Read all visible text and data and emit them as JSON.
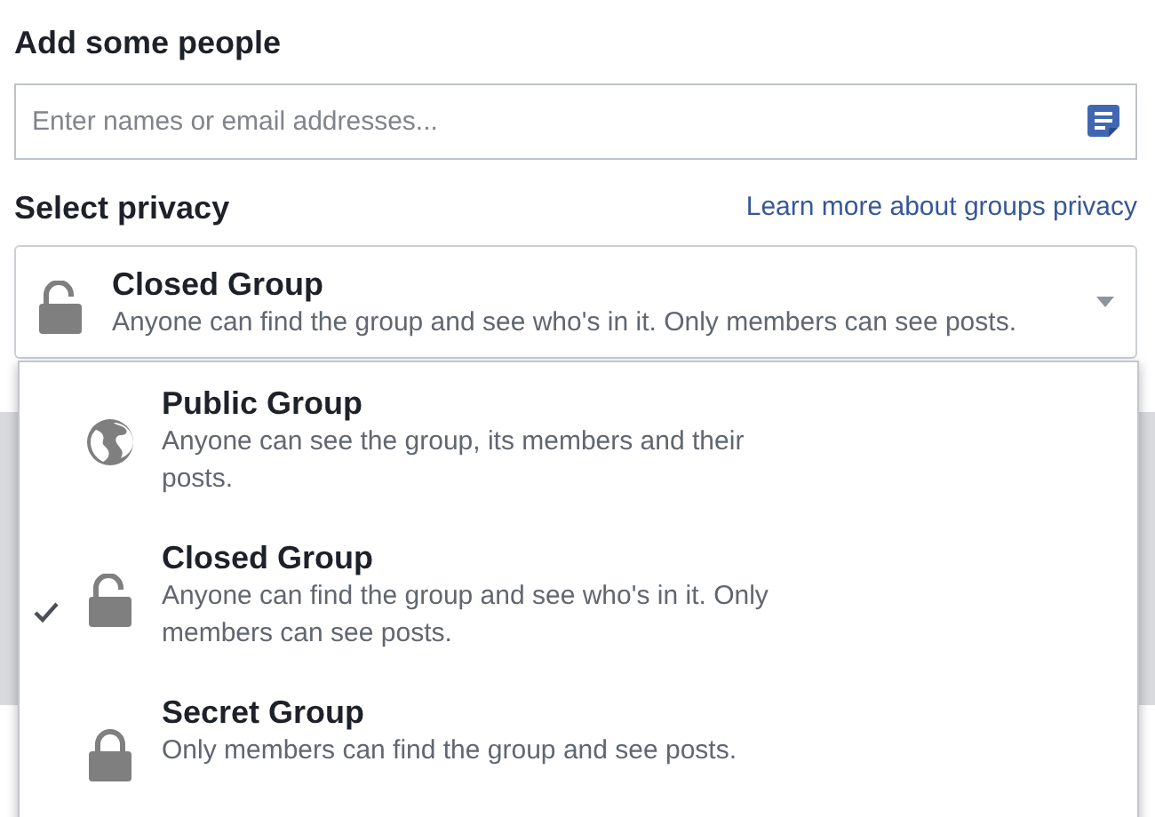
{
  "people": {
    "heading": "Add some people",
    "placeholder": "Enter names or email addresses..."
  },
  "privacy": {
    "heading": "Select privacy",
    "link": "Learn more about groups privacy",
    "current": {
      "kind": "closed",
      "title": "Closed Group",
      "description": "Anyone can find the group and see who's in it. Only members can see posts."
    },
    "options": [
      {
        "kind": "public",
        "title": "Public Group",
        "description": "Anyone can see the group, its members and their posts.",
        "selected": false
      },
      {
        "kind": "closed",
        "title": "Closed Group",
        "description": "Anyone can find the group and see who's in it. Only members can see posts.",
        "selected": true
      },
      {
        "kind": "secret",
        "title": "Secret Group",
        "description": "Only members can find the group and see posts.",
        "selected": false
      }
    ]
  }
}
